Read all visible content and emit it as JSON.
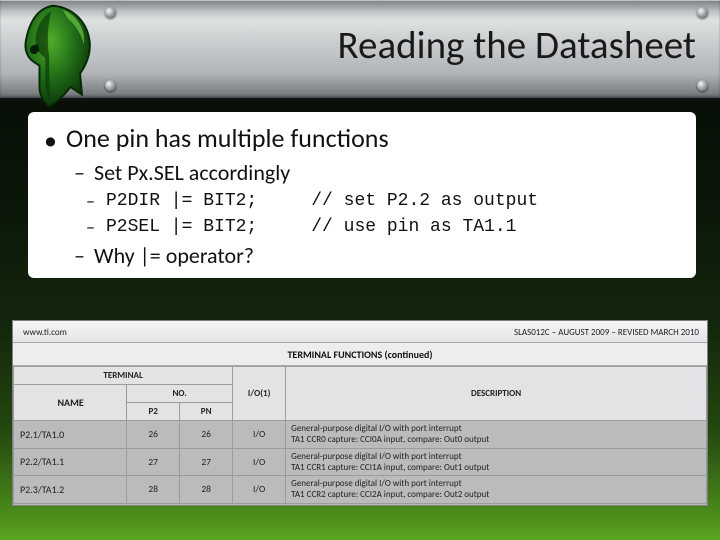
{
  "title": "Reading the Datasheet",
  "bullets": {
    "b1": "One pin has multiple functions",
    "b2a": "Set Px.SEL accordingly",
    "code1": "P2DIR |= BIT2;     // set P2.2 as output",
    "code2": "P2SEL |= BIT2;     // use pin as TA1.1",
    "b2b": "Why |= operator?"
  },
  "datasheet": {
    "site": "www.ti.com",
    "rev": "SLAS012C – AUGUST 2009 – REVISED MARCH 2010",
    "heading": "TERMINAL FUNCTIONS (continued)",
    "cols": {
      "terminal": "TERMINAL",
      "name": "NAME",
      "no": "NO.",
      "p2": "P2",
      "pn": "PN",
      "io": "I/O(1)",
      "desc": "DESCRIPTION"
    },
    "rows": [
      {
        "name": "P2.1/TA1.0",
        "p2": "26",
        "pn": "26",
        "io": "I/O",
        "desc1": "General-purpose digital I/O with port interrupt",
        "desc2": "TA1 CCR0 capture: CCI0A input, compare: Out0 output"
      },
      {
        "name": "P2.2/TA1.1",
        "p2": "27",
        "pn": "27",
        "io": "I/O",
        "desc1": "General-purpose digital I/O with port interrupt",
        "desc2": "TA1 CCR1 capture: CCI1A input, compare: Out1 output"
      },
      {
        "name": "P2.3/TA1.2",
        "p2": "28",
        "pn": "28",
        "io": "I/O",
        "desc1": "General-purpose digital I/O with port interrupt",
        "desc2": "TA1 CCR2 capture: CCI2A input, compare: Out2 output"
      }
    ]
  }
}
